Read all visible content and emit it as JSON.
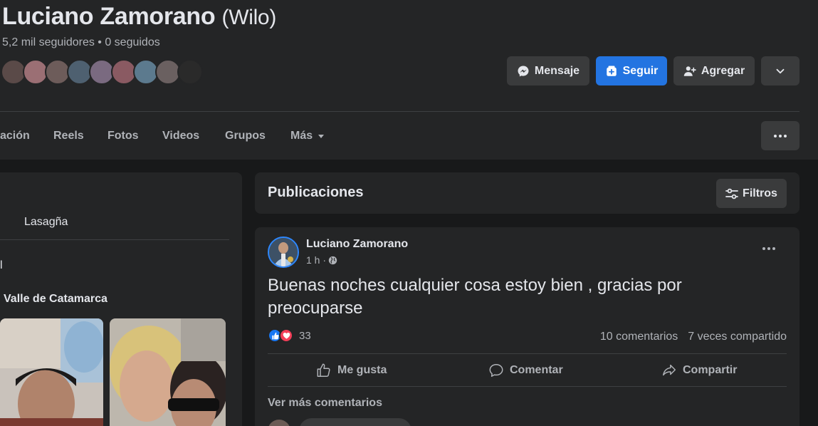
{
  "profile": {
    "name": "Luciano Zamorano",
    "alt_name": "(Wilo)",
    "stats": "5,2 mil seguidores • 0 seguidos",
    "friend_avatar_colors": [
      "#5a4a48",
      "#9b6f74",
      "#6d5c5a",
      "#4e6070",
      "#7a6a80",
      "#8a5a62",
      "#5c7a8e",
      "#6a6060",
      "#2a2a2a"
    ]
  },
  "actions": {
    "message": "Mensaje",
    "follow": "Seguir",
    "add": "Agregar"
  },
  "tabs": [
    "ación",
    "Reels",
    "Fotos",
    "Videos",
    "Grupos",
    "Más"
  ],
  "left_card": {
    "line1": "Lasagña",
    "line2": "l",
    "line3": "Valle de Catamarca"
  },
  "publications": {
    "title": "Publicaciones",
    "filters": "Filtros"
  },
  "post": {
    "author": "Luciano Zamorano",
    "time": "1 h ·",
    "text": "Buenas noches cualquier cosa estoy bien , gracias por preocuparse",
    "reaction_count": "33",
    "comments": "10 comentarios",
    "shares": "7 veces compartido",
    "like": "Me gusta",
    "comment": "Comentar",
    "share": "Compartir",
    "see_more": "Ver más comentarios"
  },
  "colors": {
    "accent": "#2374e1",
    "background": "#18191a",
    "card": "#242526"
  }
}
